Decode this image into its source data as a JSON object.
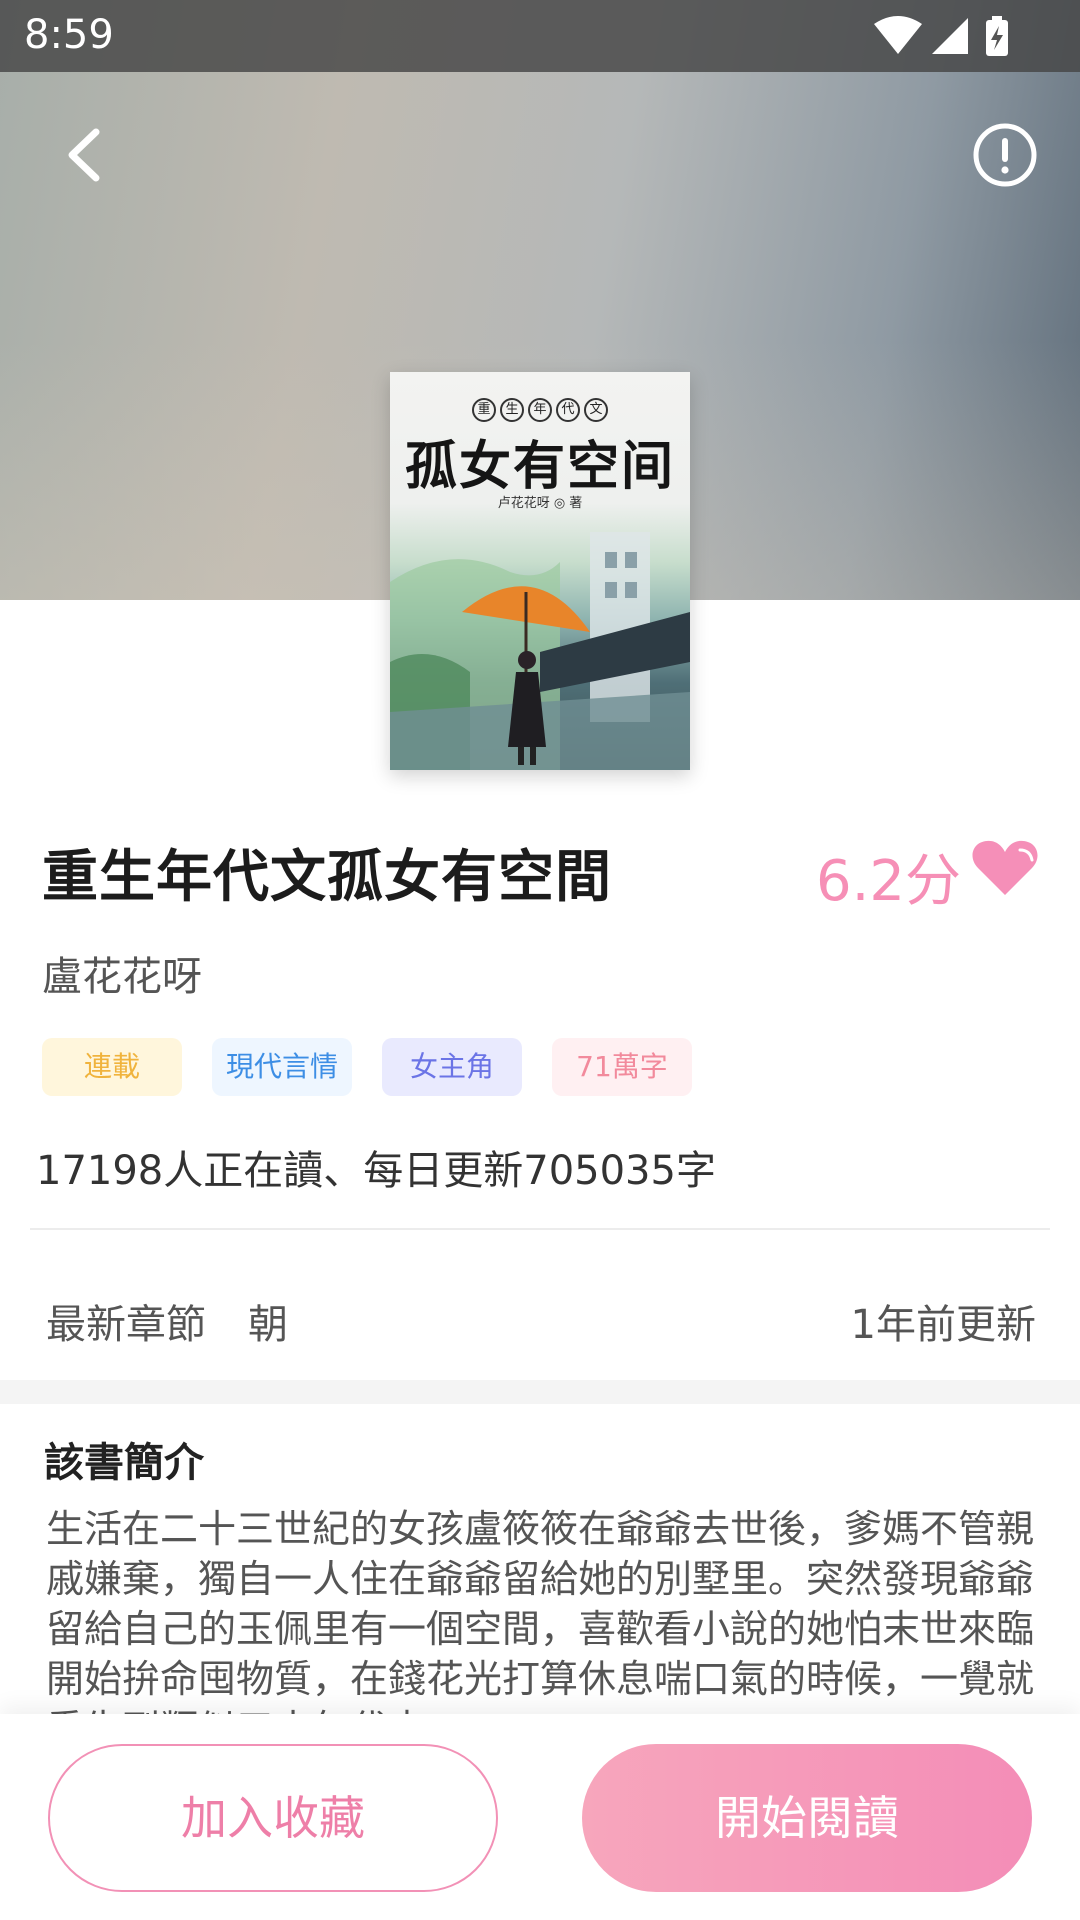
{
  "status_bar": {
    "time": "8:59",
    "icons": [
      "wifi-icon",
      "signal-icon",
      "battery-charging-icon"
    ]
  },
  "top_bar": {
    "back_icon": "chevron-left-icon",
    "report_icon": "exclamation-circle-icon"
  },
  "cover": {
    "series": [
      "重",
      "生",
      "年",
      "代",
      "文"
    ],
    "title": "孤女有空间",
    "author_line": "卢花花呀 ◎ 著"
  },
  "book": {
    "title": "重生年代文孤女有空間",
    "rating": "6.2分",
    "author": "盧花花呀",
    "tags": [
      "連載",
      "現代言情",
      "女主角",
      "71萬字"
    ],
    "stats": "17198人正在讀、每日更新705035字"
  },
  "latest": {
    "label": "最新章節",
    "chapter": "朝",
    "updated": "1年前更新"
  },
  "intro": {
    "heading": "該書簡介",
    "text": "生活在二十三世紀的女孩盧筱筱在爺爺去世後，爹媽不管親戚嫌棄，獨自一人住在爺爺留給她的別墅里。突然發現爺爺留給自己的玉佩里有一個空間，喜歡看小說的她怕末世來臨開始拚命囤物質，在錢花光打算休息喘口氣的時候，一覺就重生到類似五十年代末"
  },
  "actions": {
    "collect": "加入收藏",
    "read": "開始閱讀"
  },
  "colors": {
    "accent_pink": "#f48db7",
    "tag_yellow": "#f0b33c",
    "tag_blue": "#3d8ee5",
    "tag_purple": "#6b74e6",
    "tag_red": "#f28a9c"
  }
}
